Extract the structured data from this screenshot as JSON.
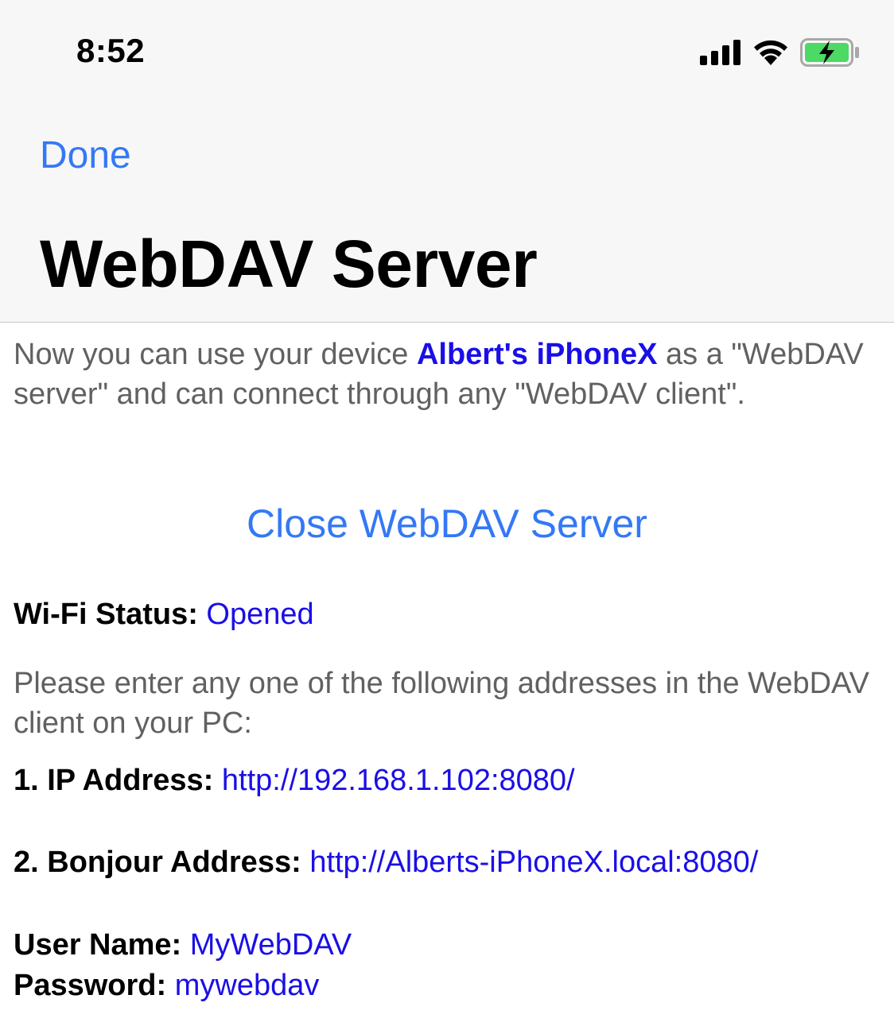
{
  "status_bar": {
    "time": "8:52",
    "icons": [
      "signal-icon",
      "wifi-icon",
      "battery-charging-icon"
    ]
  },
  "nav": {
    "done_label": "Done",
    "title": "WebDAV Server"
  },
  "intro": {
    "before": "Now you can use your device ",
    "device_name": "Albert's iPhoneX",
    "after": " as a \"WebDAV server\" and can connect through any \"WebDAV client\"."
  },
  "close_button_label": "Close WebDAV Server",
  "wifi": {
    "label": "Wi-Fi Status:",
    "value": "Opened"
  },
  "instructions": "Please enter any one of the following addresses in the WebDAV client on your PC:",
  "ip_address": {
    "label": "1. IP Address:",
    "value": "http://192.168.1.102:8080/"
  },
  "bonjour_address": {
    "label": "2. Bonjour Address:",
    "value": "http://Alberts-iPhoneX.local:8080/"
  },
  "credentials": {
    "user_label": "User Name:",
    "user_value": "MyWebDAV",
    "password_label": "Password:",
    "password_value": "mywebdav"
  },
  "colors": {
    "accent": "#3478f6",
    "value_blue": "#1a0fe6",
    "body_gray": "#616161",
    "header_bg": "#f7f7f7",
    "battery_green": "#4cd964"
  }
}
